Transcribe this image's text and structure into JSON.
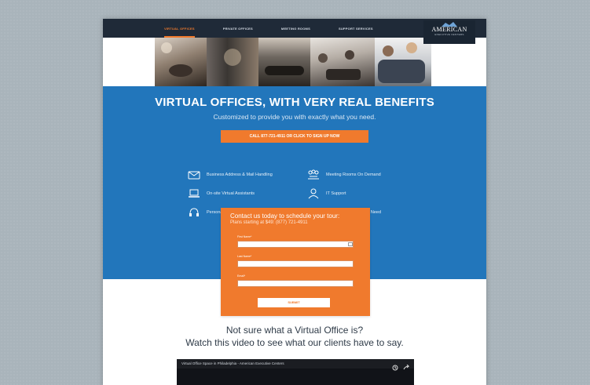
{
  "nav": {
    "items": [
      {
        "label": "VIRTUAL OFFICES",
        "active": true
      },
      {
        "label": "PRIVATE OFFICES",
        "active": false
      },
      {
        "label": "MEETING ROOMS",
        "active": false
      },
      {
        "label": "SUPPORT SERVICES",
        "active": false
      }
    ]
  },
  "logo": {
    "name": "AMERICAN",
    "sub": "EXECUTIVE CENTERS"
  },
  "hero": {
    "title": "VIRTUAL OFFICES, WITH VERY REAL BENEFITS",
    "subtitle": "Customized to provide you with exactly what you need.",
    "cta": "CALL 877-721-4911 OR CLICK TO SIGN UP NOW",
    "features": [
      {
        "icon": "mail-icon",
        "label": "Business Address & Mail Handling"
      },
      {
        "icon": "meeting-icon",
        "label": "Meeting Rooms On Demand"
      },
      {
        "icon": "laptop-icon",
        "label": "On-site Virtual Assistants"
      },
      {
        "icon": "it-support-icon",
        "label": "IT Support"
      },
      {
        "icon": "headset-icon",
        "label": "Personalized Phone Answering"
      },
      {
        "icon": "coins-icon",
        "label": "Pay Only for What You Need"
      }
    ]
  },
  "form": {
    "heading": "Contact us today to schedule your tour:",
    "plans": "Plans starting at $49: (877) 721-4911",
    "fields": [
      {
        "label": "First Name*",
        "value": ""
      },
      {
        "label": "Last Name*",
        "value": ""
      },
      {
        "label": "Email*",
        "value": ""
      }
    ],
    "submit": "SUBMIT"
  },
  "video_section": {
    "line1": "Not sure what a Virtual Office is?",
    "line2": "Watch this video to see what our clients have to say.",
    "video_title": "Virtual Office Space in Philadelphia - American Executive Centers"
  },
  "colors": {
    "navy": "#1f2a38",
    "blue": "#2276bb",
    "orange": "#f07a2d"
  }
}
